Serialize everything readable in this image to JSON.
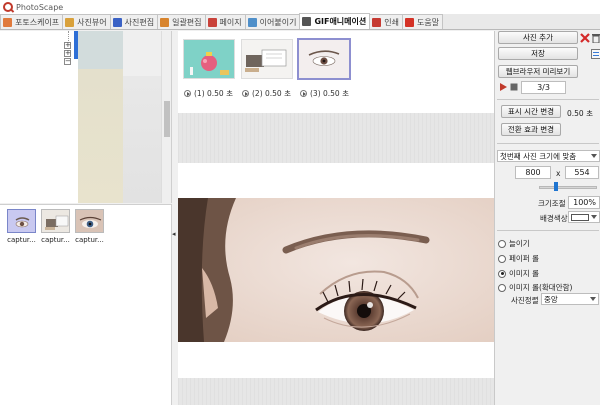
{
  "window": {
    "title": "PhotoScape"
  },
  "tabs": [
    {
      "label": "포토스케이프",
      "icon": "photoscape-tab-icon",
      "color": "#e07a3c"
    },
    {
      "label": "사진뷰어",
      "icon": "viewer-tab-icon",
      "color": "#d9a13b"
    },
    {
      "label": "사진편집",
      "icon": "editor-tab-icon",
      "color": "#3b62c5"
    },
    {
      "label": "일괄편집",
      "icon": "batch-tab-icon",
      "color": "#d8842d"
    },
    {
      "label": "페이지",
      "icon": "page-tab-icon",
      "color": "#c9423a"
    },
    {
      "label": "이어붙이기",
      "icon": "combine-tab-icon",
      "color": "#4f8fc9"
    },
    {
      "label": "GIF애니메이션",
      "icon": "gif-tab-icon",
      "color": "#555555",
      "active": true
    },
    {
      "label": "인쇄",
      "icon": "print-tab-icon",
      "color": "#c63a32"
    },
    {
      "label": "도움말",
      "icon": "help-tab-icon",
      "color": "#d43226"
    }
  ],
  "folder_tree": {
    "node_symbols": [
      "+",
      "+",
      "−"
    ]
  },
  "file_thumbnails": [
    {
      "caption": "captur...",
      "selected": true
    },
    {
      "caption": "captur...",
      "selected": false
    },
    {
      "caption": "captur...",
      "selected": false
    }
  ],
  "splitter": {
    "arrow": "◂"
  },
  "frames": [
    {
      "label": "(1) 0.50 초"
    },
    {
      "label": "(2) 0.50 초"
    },
    {
      "label": "(3) 0.50 초",
      "selected": true
    }
  ],
  "controls": {
    "add_photo": "사진 추가",
    "save": "저장",
    "browser_preview": "웹브라우저 미리보기",
    "frame_counter": "3/3",
    "change_display_time": "표시 시간 변경",
    "display_time_value": "0.50 초",
    "change_transition": "전환 효과 변경",
    "size_mode": "첫번째 사진 크기에 맞춤",
    "width": "800",
    "times": "x",
    "height": "554",
    "scale_label": "크기조절",
    "scale_value": "100%",
    "bg_color_label": "배경색상",
    "bg_color": "#ffffff",
    "fit_options": [
      {
        "label": "늘이기",
        "checked": false
      },
      {
        "label": "페이퍼 롤",
        "checked": false
      },
      {
        "label": "이미지 롤",
        "checked": true
      },
      {
        "label": "이미지 롤(확대안함)",
        "checked": false
      }
    ],
    "align_label": "사진정렬",
    "align_value": "중앙",
    "slider_level": 0.3
  }
}
